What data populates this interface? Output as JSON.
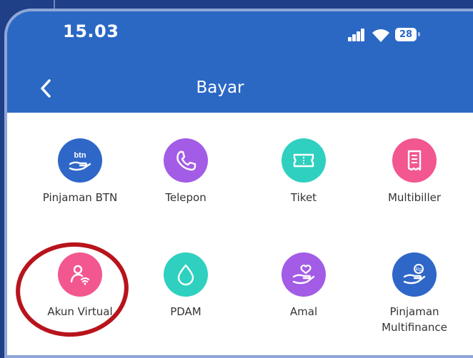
{
  "status_bar": {
    "time": "15.03",
    "battery": "28",
    "icons": [
      "signal-icon",
      "wifi-icon",
      "battery-icon"
    ]
  },
  "header": {
    "title": "Bayar",
    "back_icon": "chevron-left-icon"
  },
  "menu": {
    "items": [
      {
        "label": "Pinjaman BTN",
        "icon": "btn-loan-icon",
        "icon_text": "btn",
        "color": "#2f67c8"
      },
      {
        "label": "Telepon",
        "icon": "phone-icon",
        "color": "#a25ce6"
      },
      {
        "label": "Tiket",
        "icon": "ticket-icon",
        "color": "#2fd0c0"
      },
      {
        "label": "Multibiller",
        "icon": "receipt-icon",
        "color": "#f2578f"
      },
      {
        "label": "Akun Virtual",
        "icon": "virtual-account-icon",
        "color": "#f2578f"
      },
      {
        "label": "PDAM",
        "icon": "water-drop-icon",
        "color": "#2fd0c0"
      },
      {
        "label": "Amal",
        "icon": "charity-hand-icon",
        "color": "#a25ce6"
      },
      {
        "label": "Pinjaman Multifinance",
        "icon": "multifinance-icon",
        "icon_text": "Rp",
        "color": "#2f67c8"
      }
    ]
  },
  "colors": {
    "header_blue": "#2b68c4",
    "annotation_red": "#b8141c"
  }
}
